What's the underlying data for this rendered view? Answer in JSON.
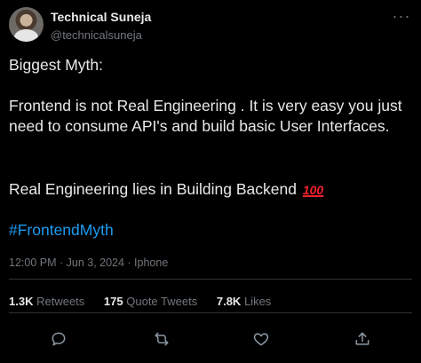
{
  "author": {
    "display_name": "Technical Suneja",
    "handle": "@technicalsuneja",
    "avatar_icon": "profile-photo"
  },
  "tweet": {
    "line_myth": "Biggest Myth:",
    "line_frontend": "Frontend is not Real Engineering . It is very easy you just need to consume API's and build basic User Interfaces.",
    "line_real": "Real Engineering lies in Building Backend",
    "emoji_hundred": "100",
    "hashtag": "#FrontendMyth",
    "hashtag_color": "#1d9bf0"
  },
  "meta": {
    "timestamp": "12:00 PM · Jun 3, 2024 · Iphone"
  },
  "stats": {
    "retweets_count": "1.3K",
    "retweets_label": "Retweets",
    "quotes_count": "175",
    "quotes_label": "Quote Tweets",
    "likes_count": "7.8K",
    "likes_label": "Likes"
  },
  "actions": {
    "reply_icon": "reply-icon",
    "retweet_icon": "retweet-icon",
    "like_icon": "heart-icon",
    "share_icon": "share-icon"
  },
  "colors": {
    "background": "#000000",
    "text": "#e7e9ea",
    "muted": "#71767b",
    "accent": "#1d9bf0",
    "divider": "#2f3336"
  }
}
